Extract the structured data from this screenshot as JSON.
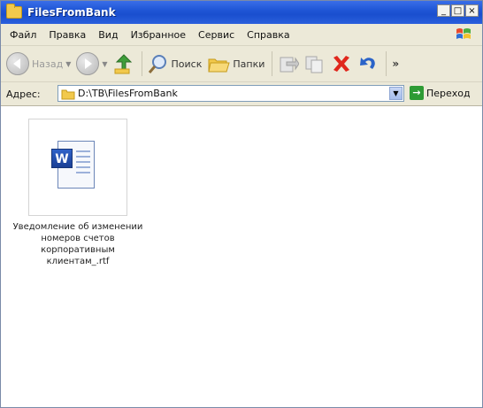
{
  "window": {
    "title": "FilesFromBank",
    "buttons": {
      "minimize": "_",
      "maximize": "□",
      "close": "×"
    }
  },
  "menu": {
    "items": [
      {
        "label": "Файл"
      },
      {
        "label": "Правка"
      },
      {
        "label": "Вид"
      },
      {
        "label": "Избранное"
      },
      {
        "label": "Сервис"
      },
      {
        "label": "Справка"
      }
    ]
  },
  "toolbar": {
    "back_label": "Назад",
    "search_label": "Поиск",
    "folders_label": "Папки"
  },
  "address": {
    "label": "Адрес:",
    "value": "D:\\TB\\FilesFromBank",
    "go_label": "Переход"
  },
  "files": [
    {
      "name": "Уведомление об изменении номеров счетов корпоративным клиентам_.rtf",
      "icon": "word-document-icon"
    }
  ],
  "colors": {
    "titlebar": "#1f56d6",
    "chrome": "#ece9d8",
    "content_bg": "#ffffff"
  }
}
